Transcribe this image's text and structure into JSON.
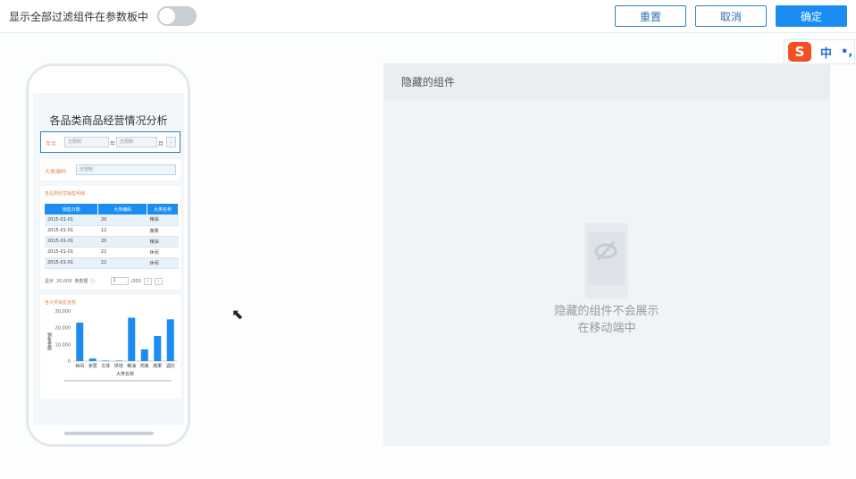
{
  "topbar": {
    "show_all_label": "显示全部过滤组件在参数板中",
    "reset_label": "重置",
    "cancel_label": "取消",
    "confirm_label": "确定"
  },
  "ime": {
    "s": "S",
    "mode": "中",
    "punct": "•,"
  },
  "phone": {
    "title": "各品类商品经营情况分析",
    "filter1": {
      "label": "年月",
      "from_placeholder": "无限制",
      "year_unit": "年",
      "to_placeholder": "无限制",
      "month_unit": "月"
    },
    "filter2": {
      "label": "大类编码",
      "placeholder": "无限制"
    },
    "table_card": {
      "title": "各品类经营销售明细",
      "columns": [
        "销售日期",
        "大类编码",
        "大类名称"
      ],
      "rows": [
        [
          "2015-01-01",
          "20",
          "粮油"
        ],
        [
          "2015-01-01",
          "12",
          "蔬果"
        ],
        [
          "2015-01-01",
          "20",
          "粮油"
        ],
        [
          "2015-01-01",
          "22",
          "休闲"
        ],
        [
          "2015-01-01",
          "22",
          "休闲"
        ]
      ],
      "footer_show": "显示",
      "footer_count": "20,000",
      "footer_unit": "条数据",
      "page_input": "1",
      "page_total": "/200"
    },
    "chart_card": {
      "title": "各大类销售金额"
    }
  },
  "chart_data": {
    "type": "bar",
    "title": "各大类销售金额",
    "xlabel": "大类名称",
    "ylabel": "销售金额",
    "categories": [
      "休闲",
      "家居",
      "文体",
      "烘培",
      "粮油",
      "肉禽",
      "蔬果",
      "酒饮"
    ],
    "values": [
      23000,
      1500,
      300,
      300,
      26000,
      7000,
      15000,
      25000
    ],
    "ylim": [
      0,
      30000
    ],
    "yticks": [
      "30,000",
      "20,000",
      "10,000",
      "0"
    ],
    "color": "#1a8cf2"
  },
  "hidden_panel": {
    "title": "隐藏的组件",
    "message_line1": "隐藏的组件不会展示",
    "message_line2": "在移动端中"
  }
}
